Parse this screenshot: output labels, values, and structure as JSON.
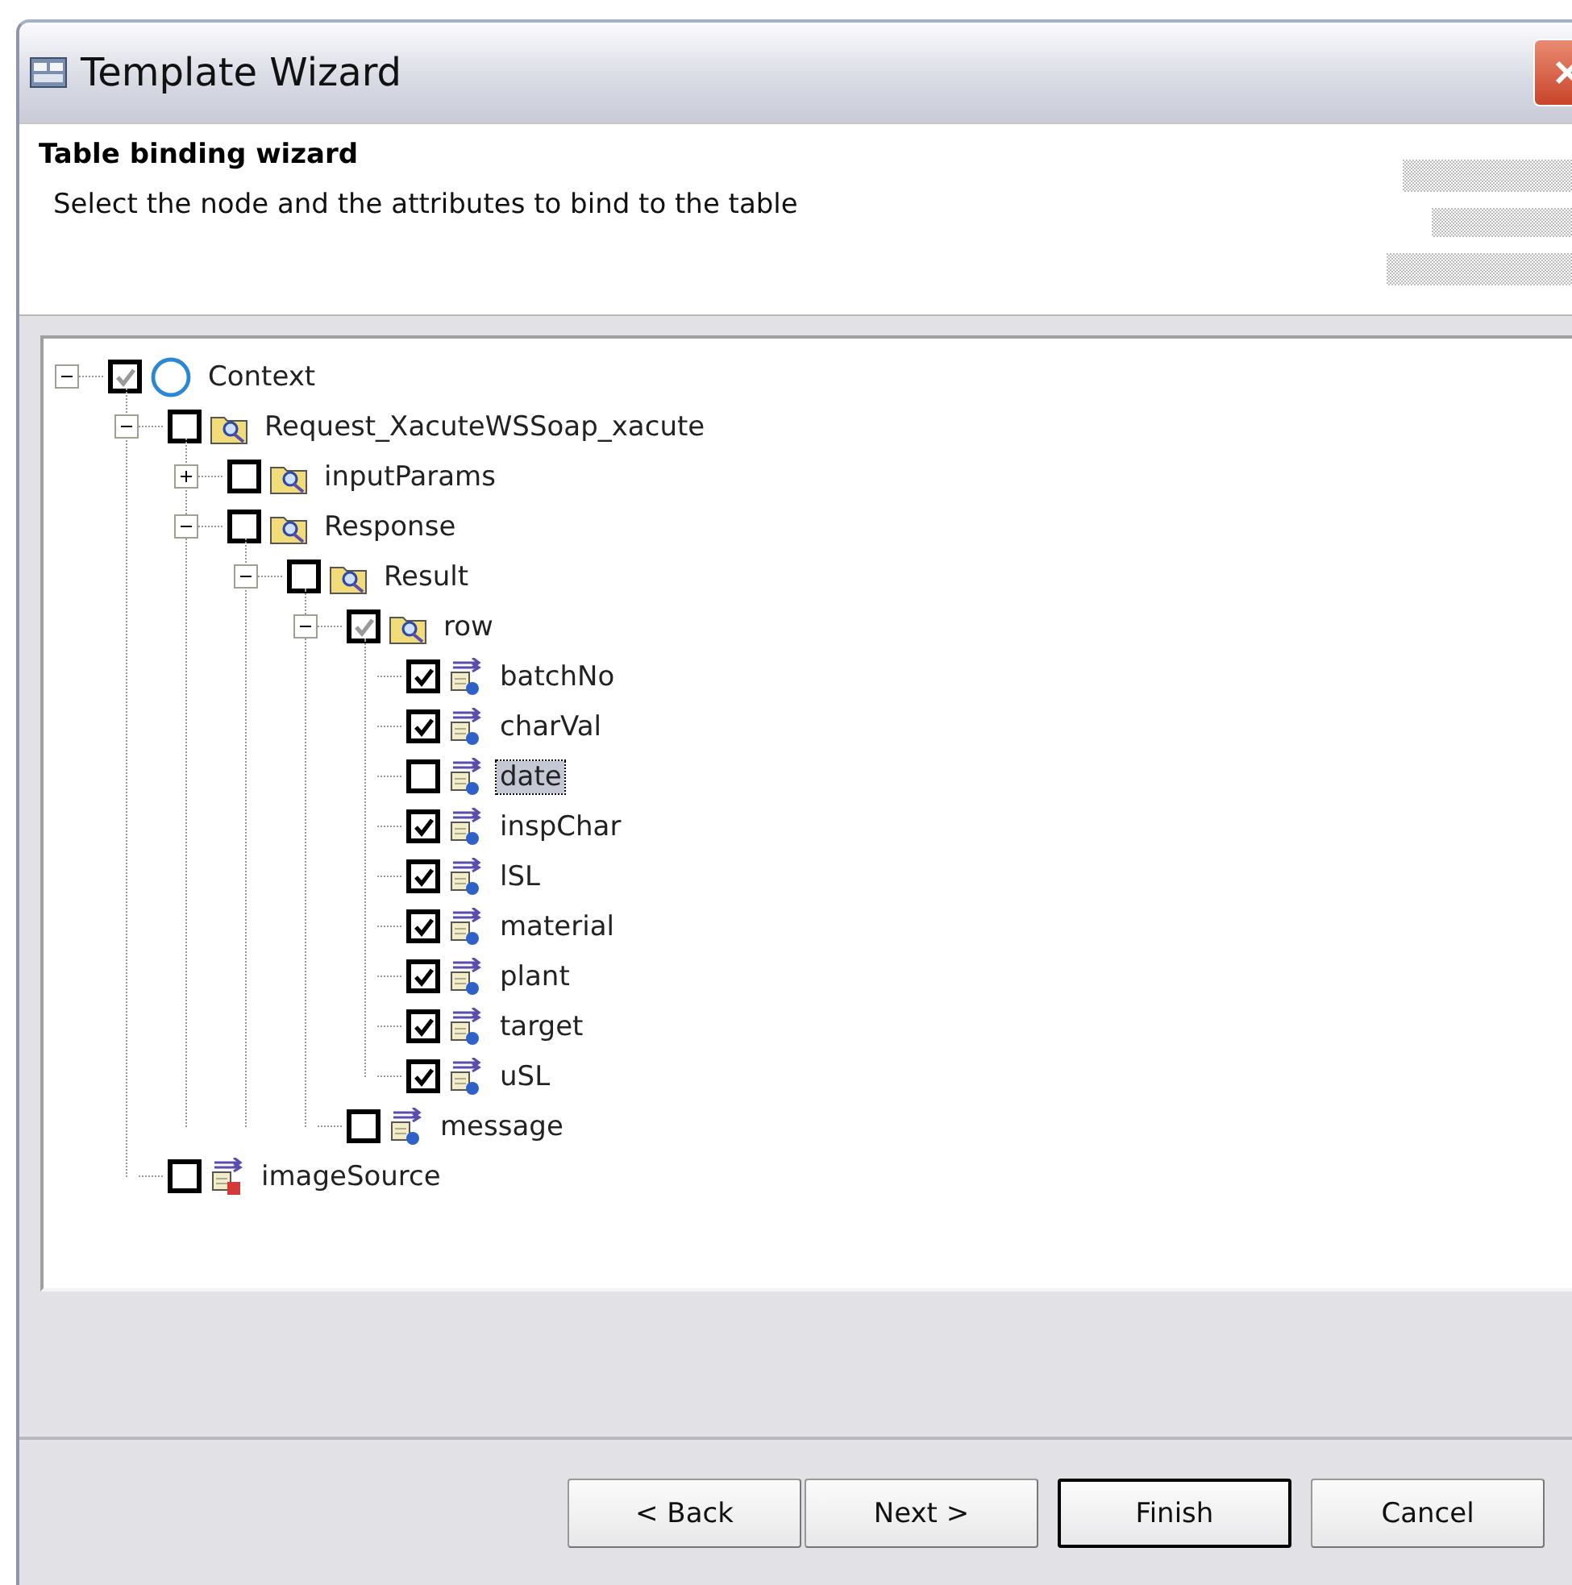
{
  "window": {
    "title": "Template Wizard"
  },
  "header": {
    "title": "Table binding wizard",
    "description": "Select the node and the attributes to bind to the table"
  },
  "tree": [
    {
      "label": "Context",
      "kind": "context",
      "checked": true,
      "grayed": true,
      "expanded": true,
      "selected": false,
      "children": [
        {
          "label": "Request_XacuteWSSoap_xacute",
          "kind": "folder",
          "checked": false,
          "expanded": true,
          "selected": false,
          "children": [
            {
              "label": "inputParams",
              "kind": "folder",
              "checked": false,
              "expanded": false,
              "selected": false
            },
            {
              "label": "Response",
              "kind": "folder",
              "checked": false,
              "expanded": true,
              "selected": false,
              "children": [
                {
                  "label": "Result",
                  "kind": "folder",
                  "checked": false,
                  "expanded": true,
                  "selected": false,
                  "children": [
                    {
                      "label": "row",
                      "kind": "folder",
                      "checked": true,
                      "grayed": true,
                      "expanded": true,
                      "selected": false,
                      "children": [
                        {
                          "label": "batchNo",
                          "kind": "attribute",
                          "checked": true,
                          "selected": false
                        },
                        {
                          "label": "charVal",
                          "kind": "attribute",
                          "checked": true,
                          "selected": false
                        },
                        {
                          "label": "date",
                          "kind": "attribute",
                          "checked": false,
                          "selected": true
                        },
                        {
                          "label": "inspChar",
                          "kind": "attribute",
                          "checked": true,
                          "selected": false
                        },
                        {
                          "label": "lSL",
                          "kind": "attribute",
                          "checked": true,
                          "selected": false
                        },
                        {
                          "label": "material",
                          "kind": "attribute",
                          "checked": true,
                          "selected": false
                        },
                        {
                          "label": "plant",
                          "kind": "attribute",
                          "checked": true,
                          "selected": false
                        },
                        {
                          "label": "target",
                          "kind": "attribute",
                          "checked": true,
                          "selected": false
                        },
                        {
                          "label": "uSL",
                          "kind": "attribute",
                          "checked": true,
                          "selected": false
                        }
                      ]
                    },
                    {
                      "label": "message",
                      "kind": "attribute",
                      "checked": false,
                      "selected": false
                    }
                  ]
                }
              ]
            }
          ]
        },
        {
          "label": "imageSource",
          "kind": "image-attribute",
          "checked": false,
          "selected": false
        }
      ]
    }
  ],
  "buttons": [
    {
      "label": "< Back",
      "default": false
    },
    {
      "label": "Next >",
      "default": false
    },
    {
      "label": "Finish",
      "default": true
    },
    {
      "label": "Cancel",
      "default": false
    }
  ]
}
